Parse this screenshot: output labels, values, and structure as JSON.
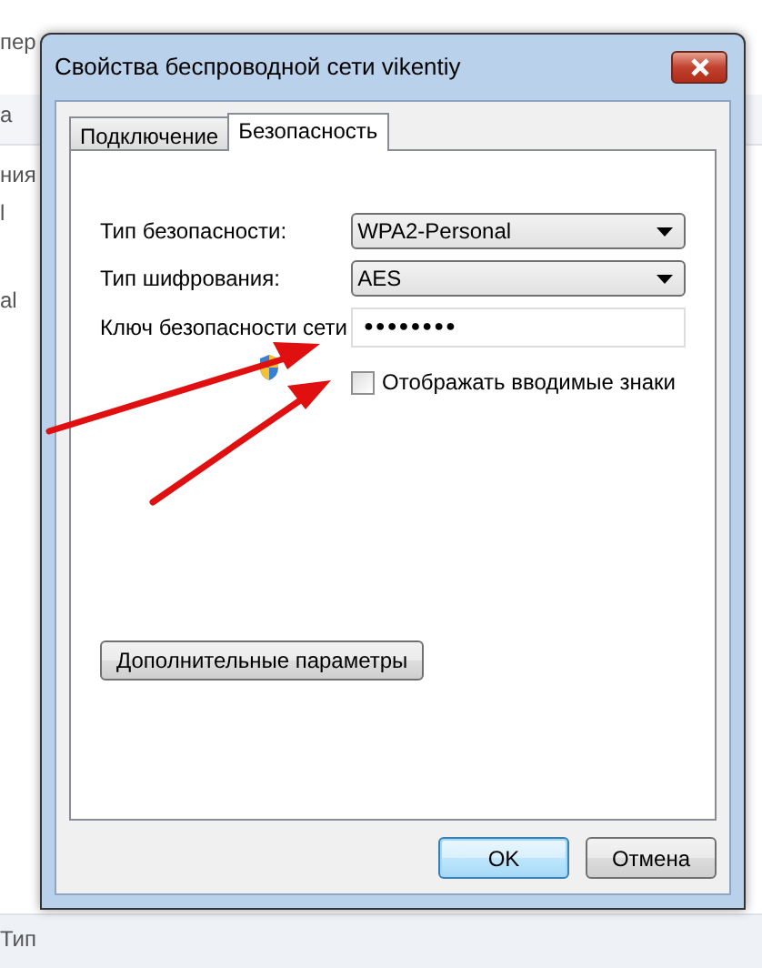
{
  "background_window": {
    "texts": [
      "пер",
      "а",
      "ния",
      "l",
      "al",
      "Тип"
    ]
  },
  "dialog": {
    "title": "Свойства беспроводной сети vikentiy",
    "tabs": [
      {
        "label": "Подключение",
        "selected": false
      },
      {
        "label": "Безопасность",
        "selected": true
      }
    ],
    "fields": [
      {
        "kind": "select",
        "label": "Тип безопасности:",
        "value": "WPA2-Personal"
      },
      {
        "kind": "select",
        "label": "Тип шифрования:",
        "value": "AES"
      },
      {
        "kind": "password",
        "label": "Ключ безопасности сети",
        "value": "●●●●●●●●"
      }
    ],
    "show_chars": {
      "label": "Отображать вводимые знаки",
      "checked": false
    },
    "advanced_button": "Дополнительные параметры",
    "buttons": [
      {
        "label": "OK",
        "default": true
      },
      {
        "label": "Отмена",
        "default": false
      }
    ]
  }
}
